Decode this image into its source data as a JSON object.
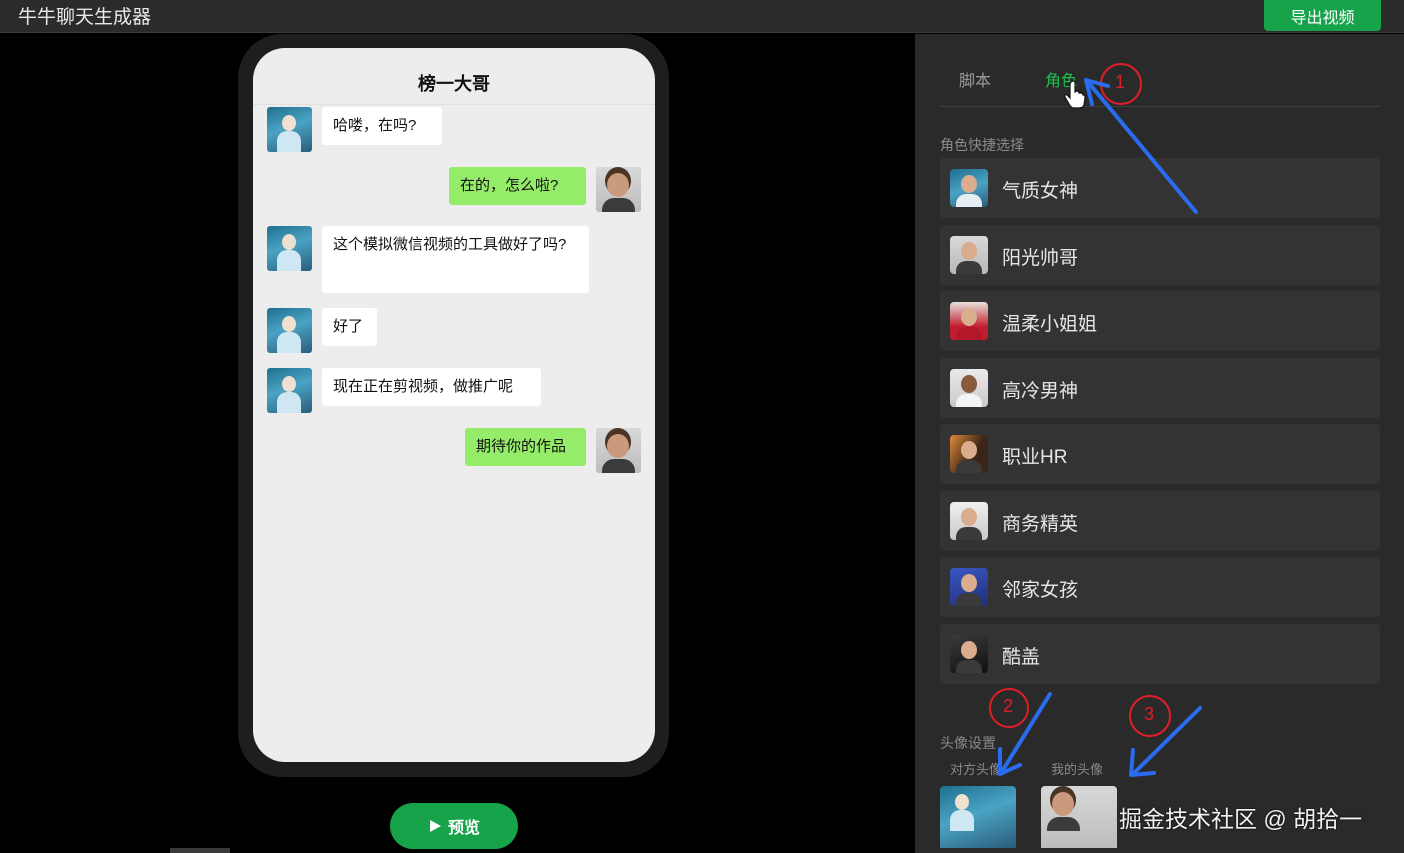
{
  "app": {
    "title": "牛牛聊天生成器",
    "export_label": "导出视频"
  },
  "chat": {
    "title": "榜一大哥",
    "messages": [
      {
        "side": "left",
        "text": "哈喽，在吗?"
      },
      {
        "side": "right",
        "text": "在的，怎么啦?"
      },
      {
        "side": "left",
        "text": "这个模拟微信视频的工具做好了吗?"
      },
      {
        "side": "left",
        "text": "好了"
      },
      {
        "side": "left",
        "text": "现在正在剪视频，做推广呢"
      },
      {
        "side": "right",
        "text": "期待你的作品"
      }
    ]
  },
  "preview": {
    "label": "预览",
    "icon": "play-icon"
  },
  "panel": {
    "tabs": [
      {
        "label": "脚本",
        "active": false
      },
      {
        "label": "角色",
        "active": true
      }
    ],
    "quick_select_label": "角色快捷选择",
    "roles": [
      {
        "label": "气质女神"
      },
      {
        "label": "阳光帅哥"
      },
      {
        "label": "温柔小姐姐"
      },
      {
        "label": "高冷男神"
      },
      {
        "label": "职业HR"
      },
      {
        "label": "商务精英"
      },
      {
        "label": "邻家女孩"
      },
      {
        "label": "酷盖"
      }
    ],
    "avatar_settings_label": "头像设置",
    "other_avatar_label": "对方头像",
    "my_avatar_label": "我的头像"
  },
  "annotations": {
    "marker1": "1",
    "marker2": "2",
    "marker3": "3"
  },
  "watermark": "掘金技术社区 @ 胡拾一",
  "colors": {
    "accent": "#16a34a",
    "tab_active": "#1fbf4f",
    "bubble_right": "#95ec69",
    "annotation_red": "#e11d2a",
    "annotation_blue": "#2a6cf0"
  }
}
